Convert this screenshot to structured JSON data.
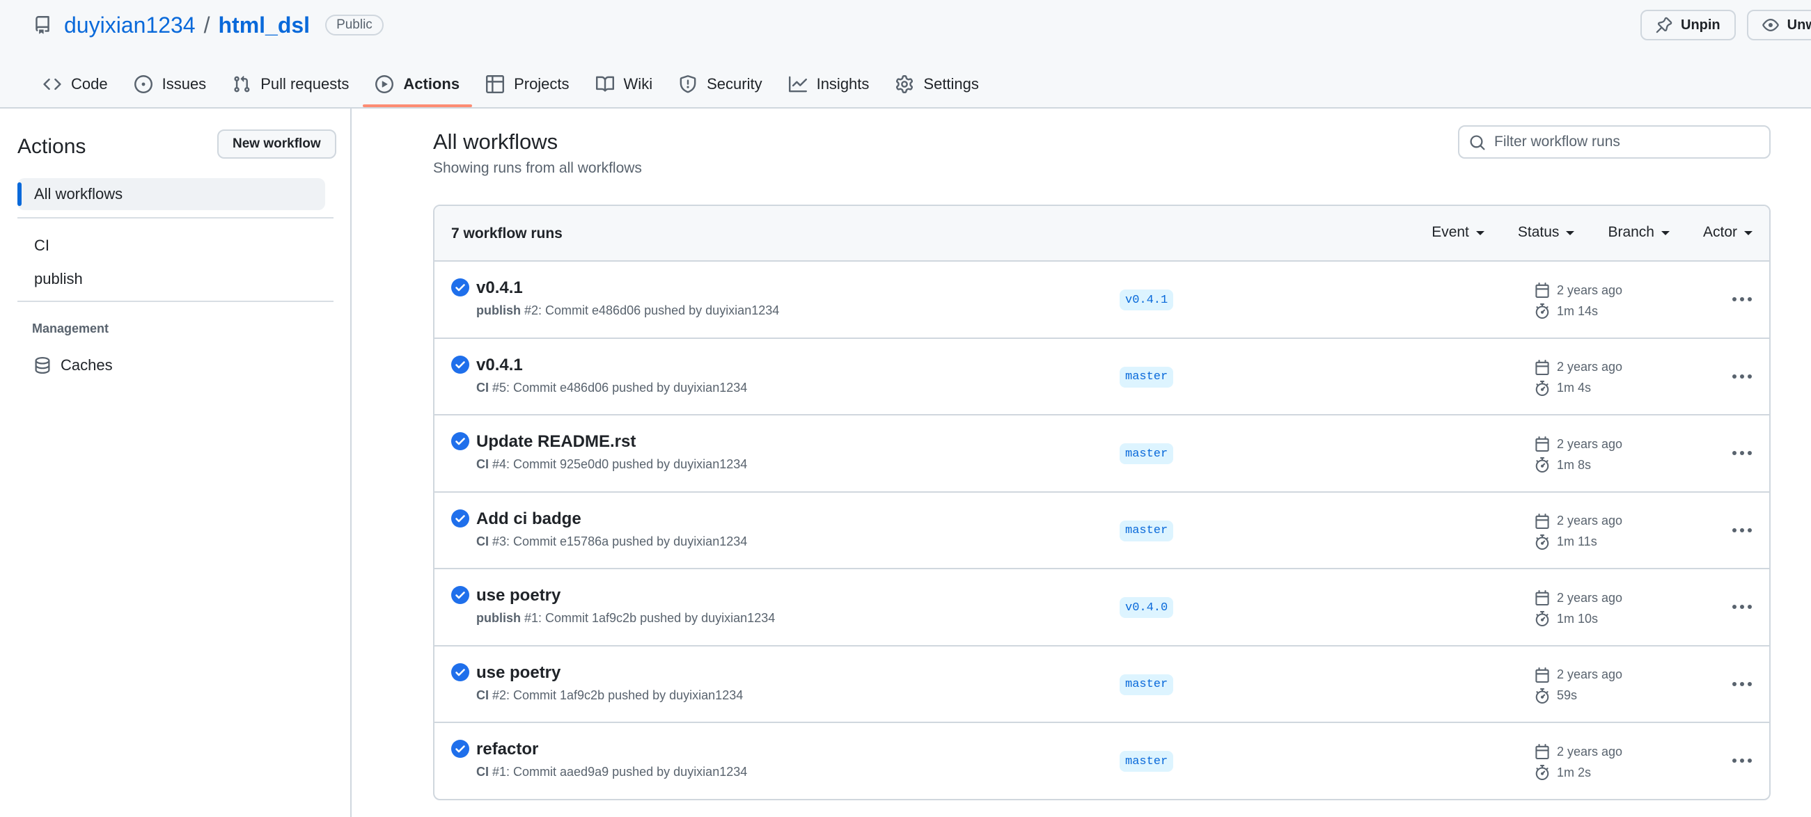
{
  "repo": {
    "owner": "duyixian1234",
    "separator": "/",
    "name": "html_dsl",
    "visibility": "Public",
    "pin_label": "Unpin",
    "watch_label": "Unwatch"
  },
  "tabs": [
    {
      "label": "Code",
      "icon": "code-icon"
    },
    {
      "label": "Issues",
      "icon": "issue-icon"
    },
    {
      "label": "Pull requests",
      "icon": "pull-request-icon"
    },
    {
      "label": "Actions",
      "icon": "play-icon",
      "selected": true
    },
    {
      "label": "Projects",
      "icon": "table-icon"
    },
    {
      "label": "Wiki",
      "icon": "book-icon"
    },
    {
      "label": "Security",
      "icon": "shield-icon"
    },
    {
      "label": "Insights",
      "icon": "graph-icon"
    },
    {
      "label": "Settings",
      "icon": "gear-icon"
    }
  ],
  "sidebar": {
    "title": "Actions",
    "new_workflow": "New workflow",
    "all_workflows": "All workflows",
    "workflows": [
      "CI",
      "publish"
    ],
    "management_heading": "Management",
    "caches": "Caches"
  },
  "main": {
    "title": "All workflows",
    "subtitle": "Showing runs from all workflows",
    "filter_placeholder": "Filter workflow runs",
    "runs_count": "7 workflow runs",
    "filters": [
      "Event",
      "Status",
      "Branch",
      "Actor"
    ]
  },
  "runs": [
    {
      "title": "v0.4.1",
      "workflow": "publish",
      "meta": " #2: Commit e486d06 pushed by duyixian1234",
      "branch": "v0.4.1",
      "when": "2 years ago",
      "duration": "1m 14s"
    },
    {
      "title": "v0.4.1",
      "workflow": "CI",
      "meta": " #5: Commit e486d06 pushed by duyixian1234",
      "branch": "master",
      "when": "2 years ago",
      "duration": "1m 4s"
    },
    {
      "title": "Update README.rst",
      "workflow": "CI",
      "meta": " #4: Commit 925e0d0 pushed by duyixian1234",
      "branch": "master",
      "when": "2 years ago",
      "duration": "1m 8s"
    },
    {
      "title": "Add ci badge",
      "workflow": "CI",
      "meta": " #3: Commit e15786a pushed by duyixian1234",
      "branch": "master",
      "when": "2 years ago",
      "duration": "1m 11s"
    },
    {
      "title": "use poetry",
      "workflow": "publish",
      "meta": " #1: Commit 1af9c2b pushed by duyixian1234",
      "branch": "v0.4.0",
      "when": "2 years ago",
      "duration": "1m 10s"
    },
    {
      "title": "use poetry",
      "workflow": "CI",
      "meta": " #2: Commit 1af9c2b pushed by duyixian1234",
      "branch": "master",
      "when": "2 years ago",
      "duration": "59s"
    },
    {
      "title": "refactor",
      "workflow": "CI",
      "meta": " #1: Commit aaed9a9 pushed by duyixian1234",
      "branch": "master",
      "when": "2 years ago",
      "duration": "1m 2s"
    }
  ],
  "colors": {
    "accent": "#0969da",
    "success": "#1f6feb",
    "tab_underline": "#fd8c73",
    "border": "#d0d7de"
  }
}
